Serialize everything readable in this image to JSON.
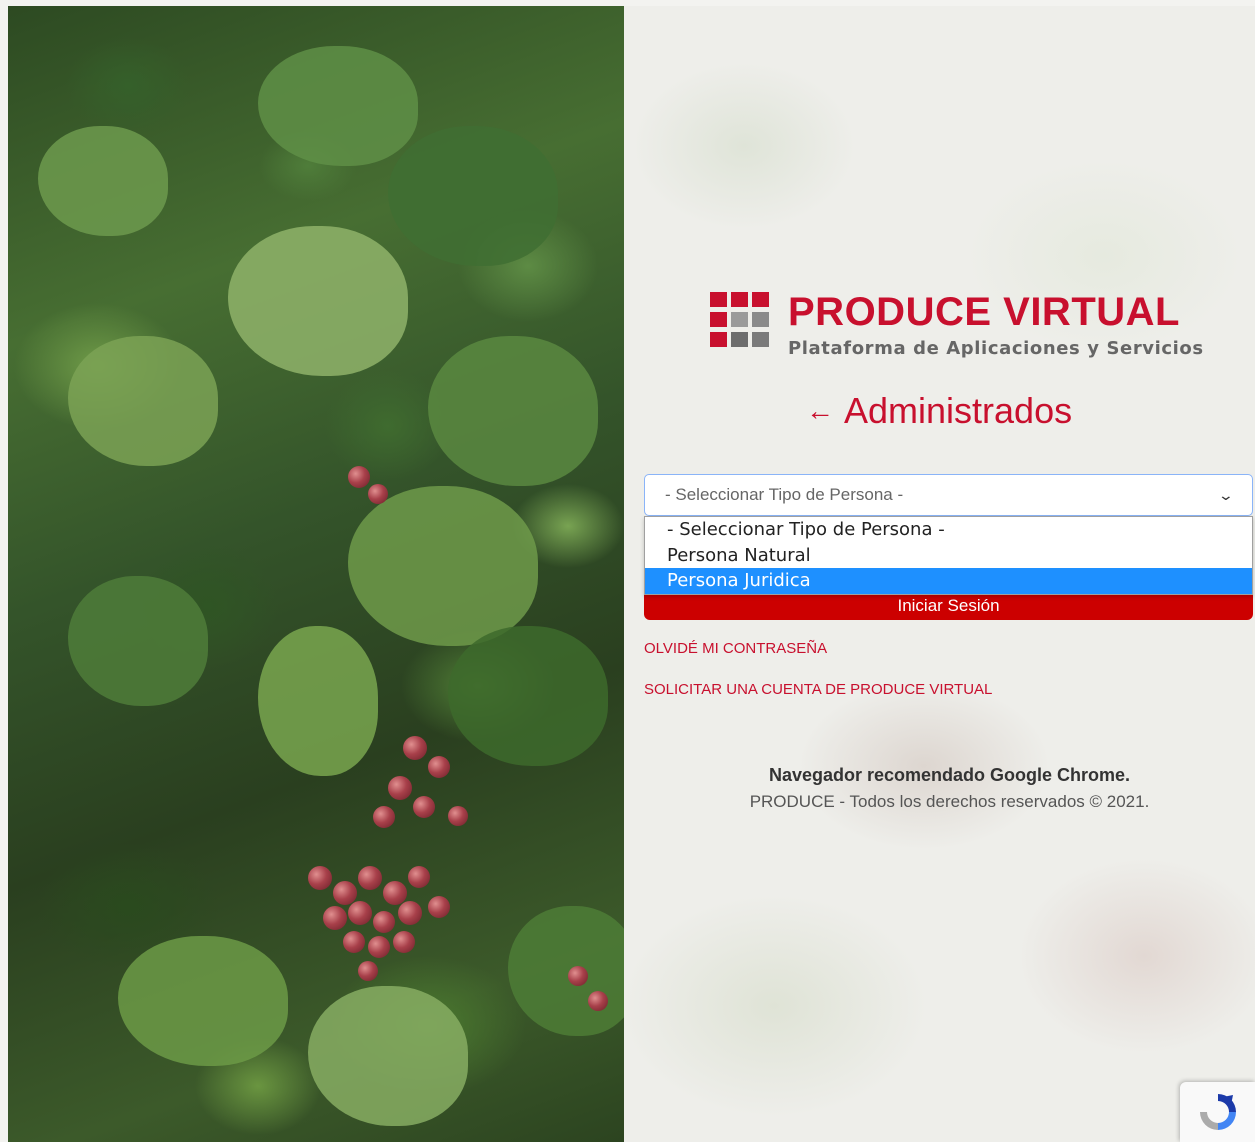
{
  "brand": {
    "title": "PRODUCE VIRTUAL",
    "subtitle": "Plataforma de Aplicaciones y Servicios",
    "colors": {
      "primary": "#c8102e",
      "grey": "#666666"
    }
  },
  "heading": {
    "arrow": "←",
    "text": "Administrados"
  },
  "person_type_select": {
    "selected": "- Seleccionar Tipo de Persona -",
    "options": [
      "- Seleccionar Tipo de Persona -",
      "Persona Natural",
      "Persona Juridica"
    ],
    "highlighted": "Persona Juridica"
  },
  "login_button": {
    "label": "Iniciar Sesión"
  },
  "links": {
    "forgot_password": "OLVIDÉ MI CONTRASEÑA",
    "request_account": "SOLICITAR UNA CUENTA DE PRODUCE VIRTUAL"
  },
  "footer": {
    "recommendation": "Navegador recomendado Google Chrome.",
    "copyright": "PRODUCE - Todos los derechos reservados © 2021."
  },
  "icons": {
    "recaptcha": "recaptcha-icon",
    "dropdown": "chevron-down-icon"
  }
}
